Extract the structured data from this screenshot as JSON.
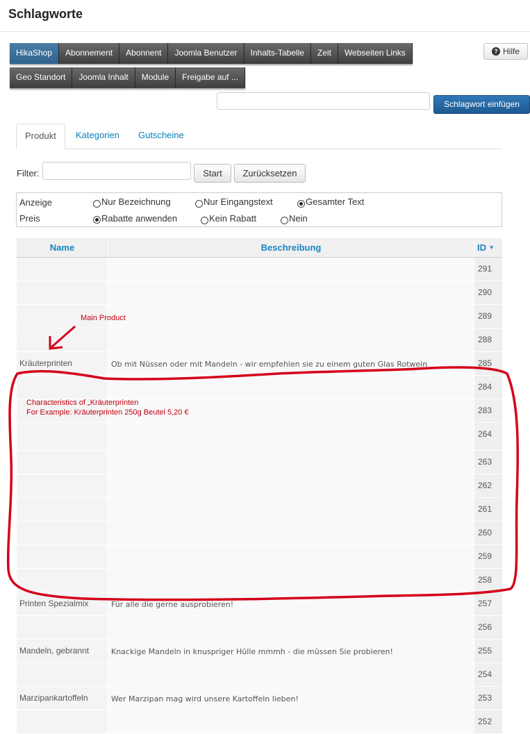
{
  "page": {
    "title": "Schlagworte"
  },
  "toolbar": {
    "row1": [
      "HikaShop",
      "Abonnement",
      "Abonnent",
      "Joomla Benutzer",
      "Inhalts-Tabelle",
      "Zeit",
      "Webseiten Links"
    ],
    "row2": [
      "Geo Standort",
      "Joomla Inhalt",
      "Module",
      "Freigabe auf ..."
    ],
    "help_label": "Hilfe",
    "insert_label": "Schlagwort einfügen",
    "tag_input_value": ""
  },
  "tabs": [
    "Produkt",
    "Kategorien",
    "Gutscheine"
  ],
  "filter": {
    "label": "Filter:",
    "value": "",
    "start_label": "Start",
    "reset_label": "Zurücksetzen"
  },
  "options": {
    "anzeige_label": "Anzeige",
    "anzeige_options": [
      "Nur Bezeichnung",
      "Nur Eingangstext",
      "Gesamter Text"
    ],
    "anzeige_selected": "Gesamter Text",
    "preis_label": "Preis",
    "preis_options": [
      "Rabatte anwenden",
      "Kein Rabatt",
      "Nein"
    ],
    "preis_selected": "Rabatte anwenden"
  },
  "table": {
    "columns": {
      "name": "Name",
      "description": "Beschreibung",
      "id": "ID",
      "id_sort_indicator": "▼"
    },
    "rows": [
      {
        "name": "",
        "description": "",
        "id": "291"
      },
      {
        "name": "",
        "description": "",
        "id": "290"
      },
      {
        "name": "",
        "description": "",
        "id": "289"
      },
      {
        "name": "",
        "description": "",
        "id": "288"
      },
      {
        "name": "Kräuterprinten",
        "description": "Ob mit Nüssen oder mit Mandeln - wir empfehlen sie zu einem guten Glas Rotwein",
        "id": "285"
      },
      {
        "name": "",
        "description": "",
        "id": "284"
      },
      {
        "name": "",
        "description": "",
        "id": "283"
      },
      {
        "name": "",
        "description": "",
        "id": "264"
      },
      {
        "name": "",
        "description": "",
        "id": "263"
      },
      {
        "name": "",
        "description": "",
        "id": "262"
      },
      {
        "name": "",
        "description": "",
        "id": "261"
      },
      {
        "name": "",
        "description": "",
        "id": "260"
      },
      {
        "name": "",
        "description": "",
        "id": "259"
      },
      {
        "name": "",
        "description": "",
        "id": "258"
      },
      {
        "name": "Printen Spezialmix",
        "description": "Für alle die gerne ausprobieren!",
        "id": "257"
      },
      {
        "name": "",
        "description": "",
        "id": "256"
      },
      {
        "name": "Mandeln, gebrannt",
        "description": "Knackige Mandeln in knuspriger Hülle mmmh - die müssen Sie probieren!",
        "id": "255"
      },
      {
        "name": "",
        "description": "",
        "id": "254"
      },
      {
        "name": "Marzipankartoffeln",
        "description": "Wer Marzipan mag wird unsere Kartoffeln lieben!",
        "id": "253"
      },
      {
        "name": "",
        "description": "",
        "id": "252"
      }
    ]
  },
  "annotations": {
    "main_product": "Main Product",
    "characteristics_line1": "Characteristics of „Kräuterprinten",
    "characteristics_line2": "For Example: Kräuterprinten 250g Beutel    5,20 €"
  },
  "colors": {
    "annotation_red": "#d4001a",
    "active_blue": "#2f628c",
    "link_blue": "#1a84c0"
  }
}
